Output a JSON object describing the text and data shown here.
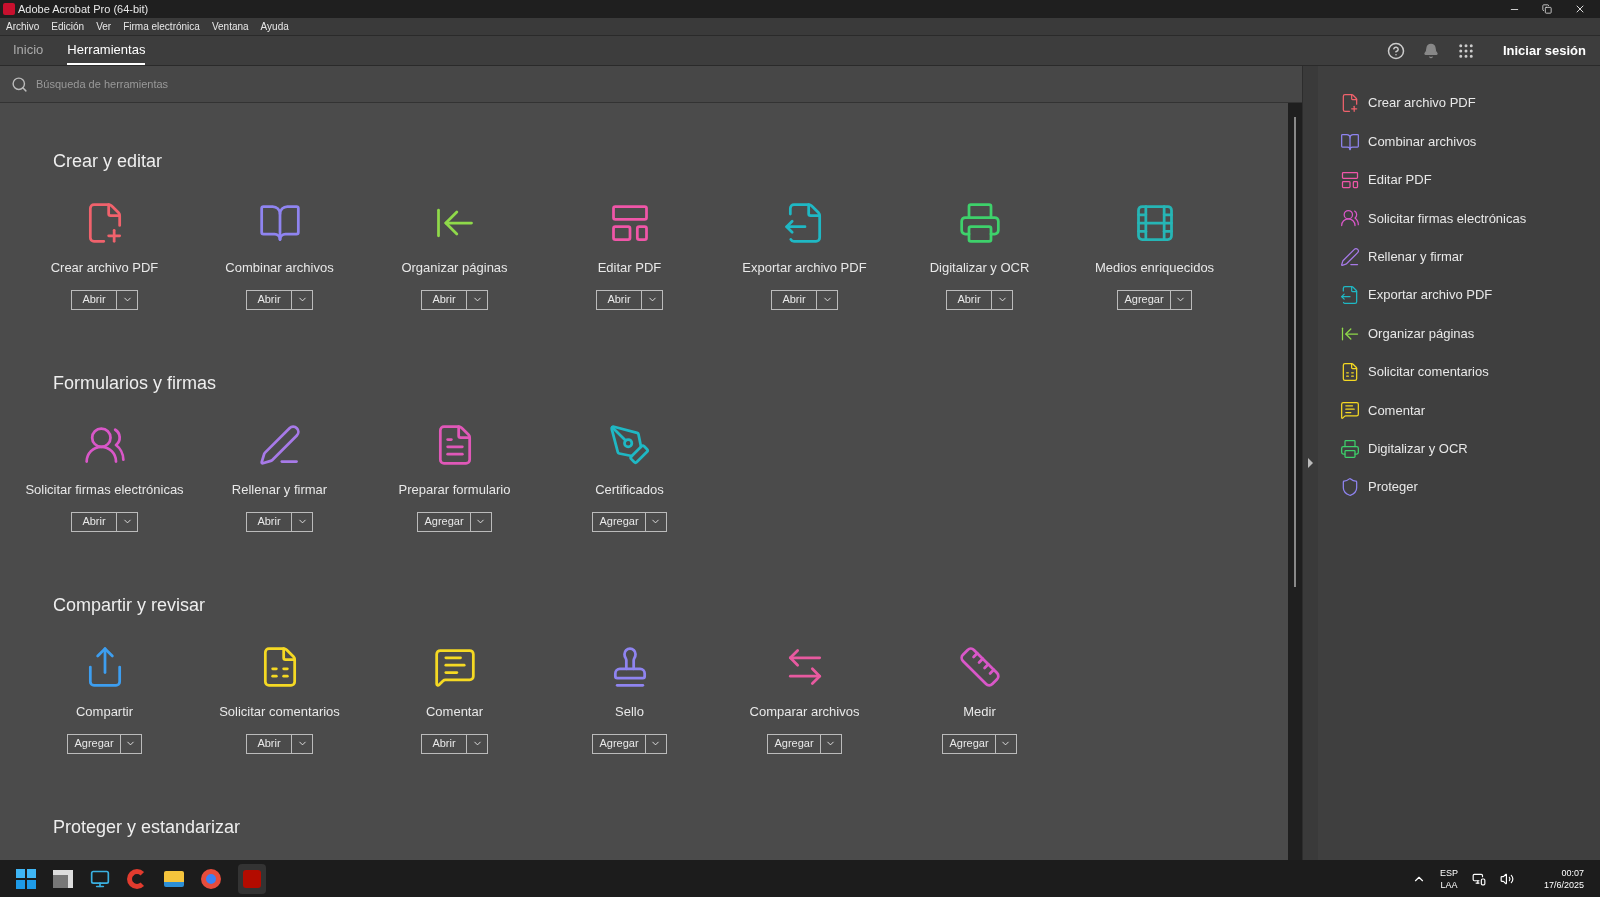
{
  "window": {
    "title": "Adobe Acrobat Pro (64-bit)"
  },
  "menu": [
    "Archivo",
    "Edición",
    "Ver",
    "Firma electrónica",
    "Ventana",
    "Ayuda"
  ],
  "tabs": [
    {
      "label": "Inicio",
      "selected": false
    },
    {
      "label": "Herramientas",
      "selected": true
    }
  ],
  "header_actions": {
    "sign_in": "Iniciar sesión"
  },
  "search": {
    "placeholder": "Búsqueda de herramientas"
  },
  "sections": [
    {
      "title": "Crear y editar",
      "tools": [
        {
          "kind": "create",
          "color": "#f0626c",
          "label": "Crear archivo PDF",
          "action": "Abrir"
        },
        {
          "kind": "combine",
          "color": "#8f84f0",
          "label": "Combinar archivos",
          "action": "Abrir"
        },
        {
          "kind": "organize",
          "color": "#8fd94a",
          "label": "Organizar páginas",
          "action": "Abrir"
        },
        {
          "kind": "edit",
          "color": "#f056a8",
          "label": "Editar PDF",
          "action": "Abrir"
        },
        {
          "kind": "export",
          "color": "#1fb8c4",
          "label": "Exportar archivo PDF",
          "action": "Abrir"
        },
        {
          "kind": "scan",
          "color": "#3ed16b",
          "label": "Digitalizar y OCR",
          "action": "Abrir"
        },
        {
          "kind": "media",
          "color": "#26b5b5",
          "label": "Medios enriquecidos",
          "action": "Agregar"
        }
      ]
    },
    {
      "title": "Formularios y firmas",
      "tools": [
        {
          "kind": "request-sign",
          "color": "#d957c8",
          "label": "Solicitar firmas electrónicas",
          "action": "Abrir"
        },
        {
          "kind": "fill-sign",
          "color": "#a77ae8",
          "label": "Rellenar y firmar",
          "action": "Abrir"
        },
        {
          "kind": "form",
          "color": "#e058b8",
          "label": "Preparar formulario",
          "action": "Agregar"
        },
        {
          "kind": "certificate",
          "color": "#1fb8c4",
          "label": "Certificados",
          "action": "Agregar"
        }
      ]
    },
    {
      "title": "Compartir y revisar",
      "tools": [
        {
          "kind": "share",
          "color": "#3d9ef0",
          "label": "Compartir",
          "action": "Agregar"
        },
        {
          "kind": "request-comments",
          "color": "#f5d923",
          "label": "Solicitar comentarios",
          "action": "Abrir"
        },
        {
          "kind": "comment",
          "color": "#f5d923",
          "label": "Comentar",
          "action": "Abrir"
        },
        {
          "kind": "stamp",
          "color": "#8f84f0",
          "label": "Sello",
          "action": "Agregar"
        },
        {
          "kind": "compare",
          "color": "#e85aa0",
          "label": "Comparar archivos",
          "action": "Agregar"
        },
        {
          "kind": "measure",
          "color": "#d957c8",
          "label": "Medir",
          "action": "Agregar"
        }
      ]
    },
    {
      "title": "Proteger y estandarizar"
    }
  ],
  "side_panel": [
    {
      "kind": "create",
      "color": "#f0626c",
      "label": "Crear archivo PDF"
    },
    {
      "kind": "combine",
      "color": "#8f84f0",
      "label": "Combinar archivos"
    },
    {
      "kind": "edit",
      "color": "#f056a8",
      "label": "Editar PDF"
    },
    {
      "kind": "request-sign",
      "color": "#d957c8",
      "label": "Solicitar firmas electrónicas"
    },
    {
      "kind": "fill-sign",
      "color": "#a77ae8",
      "label": "Rellenar y firmar"
    },
    {
      "kind": "export",
      "color": "#1fb8c4",
      "label": "Exportar archivo PDF"
    },
    {
      "kind": "organize",
      "color": "#8fd94a",
      "label": "Organizar páginas"
    },
    {
      "kind": "request-comments",
      "color": "#f5d923",
      "label": "Solicitar comentarios"
    },
    {
      "kind": "comment",
      "color": "#f5d923",
      "label": "Comentar"
    },
    {
      "kind": "scan",
      "color": "#3ed16b",
      "label": "Digitalizar y OCR"
    },
    {
      "kind": "protect",
      "color": "#8f84f0",
      "label": "Proteger"
    }
  ],
  "taskbar": {
    "language": "ESP",
    "layout": "LAA",
    "time": "00:07",
    "date": "17/6/2025"
  }
}
